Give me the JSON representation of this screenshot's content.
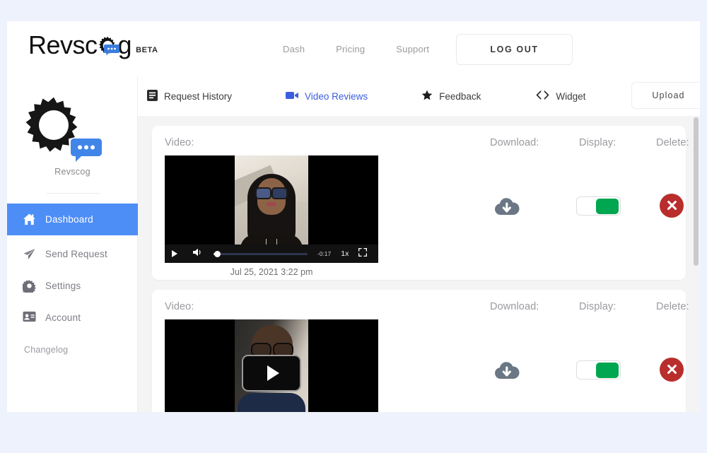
{
  "brand": {
    "name_before": "Revsc",
    "name_after": "g",
    "badge": "BETA",
    "cog_icon": "cog-chat-icon"
  },
  "top_nav": {
    "links": [
      {
        "label": "Dash",
        "name": "nav-dash"
      },
      {
        "label": "Pricing",
        "name": "nav-pricing"
      },
      {
        "label": "Support",
        "name": "nav-support"
      }
    ],
    "logout_label": "LOG OUT"
  },
  "tabs": [
    {
      "label": "Request History",
      "icon": "document-list-icon",
      "active": false
    },
    {
      "label": "Video Reviews",
      "icon": "video-camera-icon",
      "active": true
    },
    {
      "label": "Feedback",
      "icon": "star-icon",
      "active": false
    },
    {
      "label": "Widget",
      "icon": "code-brackets-icon",
      "active": false
    }
  ],
  "upload_label": "Upload",
  "sidebar": {
    "logo_icon": "cog-chat-logo",
    "logo_name": "Revscog",
    "items": [
      {
        "label": "Dashboard",
        "icon": "home-icon",
        "active": true
      },
      {
        "label": "Send Request",
        "icon": "paper-plane-icon",
        "active": false
      },
      {
        "label": "Settings",
        "icon": "gear-icon",
        "active": false
      },
      {
        "label": "Account",
        "icon": "id-card-icon",
        "active": false
      },
      {
        "label": "Changelog",
        "icon": "",
        "active": false
      }
    ]
  },
  "content": {
    "column_labels": {
      "video": "Video:",
      "download": "Download:",
      "display": "Display:",
      "delete": "Delete:"
    },
    "cards": [
      {
        "id": "video-card-0",
        "date": "Jul 25, 2021 3:22 pm",
        "player": {
          "time_remaining": "-0:17",
          "playback_rate": "1x",
          "progress_percent": 3,
          "show_play_overlay": false
        },
        "download_icon": "cloud-download-icon",
        "display_enabled": true,
        "delete_icon": "circle-x-icon"
      },
      {
        "id": "video-card-1",
        "date": "",
        "player": {
          "time_remaining": "",
          "playback_rate": "",
          "progress_percent": 0,
          "show_play_overlay": true
        },
        "download_icon": "cloud-download-icon",
        "display_enabled": true,
        "delete_icon": "circle-x-icon"
      }
    ]
  },
  "colors": {
    "page_background": "#eef2fc",
    "accent_blue": "#4d8df6",
    "tab_active_blue": "#3b5ee0",
    "toggle_green": "#00a650",
    "delete_red": "#b92d2d",
    "content_background": "#f4f4f4"
  }
}
